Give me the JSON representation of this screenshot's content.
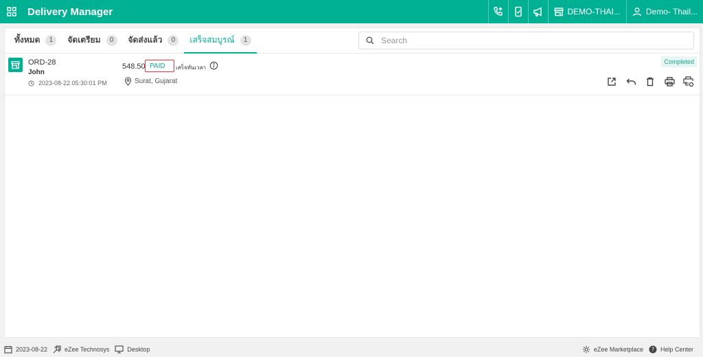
{
  "app": {
    "title": "Delivery Manager"
  },
  "topbar": {
    "store_label": "DEMO-THAI...",
    "user_label": "Demo- Thail..."
  },
  "tabs": [
    {
      "label": "ทั้งหมด",
      "count": "1"
    },
    {
      "label": "จัดเตรียม",
      "count": "0"
    },
    {
      "label": "จัดส่งแล้ว",
      "count": "0"
    },
    {
      "label": "เสร็จสมบูรณ์",
      "count": "1"
    }
  ],
  "search": {
    "placeholder": "Search"
  },
  "order": {
    "id": "ORD-28",
    "customer": "John",
    "timestamp": "2023-08-22 05:30:01 PM",
    "amount": "548.50",
    "payment": "PAID",
    "delivery_note": "เสร็จทันเวลา",
    "location": "Surat, Gujarat",
    "status": "Completed"
  },
  "footer": {
    "date": "2023-08-22",
    "company": "eZee Technosys",
    "device": "Desktop",
    "marketplace": "eZee Marketplace",
    "help": "Help Center"
  },
  "colors": {
    "accent": "#00b093",
    "paid_border": "#ee3333"
  }
}
